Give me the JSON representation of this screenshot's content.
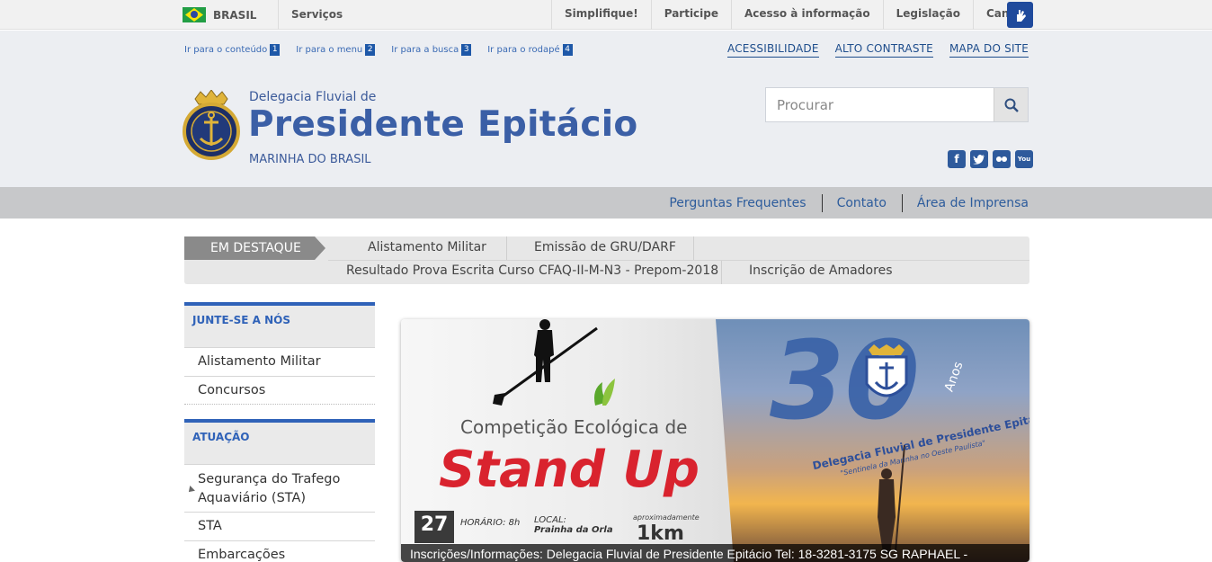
{
  "govbar": {
    "brasil_label": "BRASIL",
    "servicos_label": "Serviços",
    "links": [
      "Simplifique!",
      "Participe",
      "Acesso à informação",
      "Legislação",
      "Canais"
    ],
    "vlibras_icon": "vlibras-hand-icon"
  },
  "skip_links": [
    {
      "label": "Ir para o conteúdo",
      "num": "1"
    },
    {
      "label": "Ir para o menu",
      "num": "2"
    },
    {
      "label": "Ir para a busca",
      "num": "3"
    },
    {
      "label": "Ir para o rodapé",
      "num": "4"
    }
  ],
  "access_links": [
    "ACESSIBILIDADE",
    "ALTO CONTRASTE",
    "MAPA DO SITE"
  ],
  "site": {
    "small": "Delegacia Fluvial de",
    "title": "Presidente Epitácio",
    "subtitle": "MARINHA DO BRASIL"
  },
  "search": {
    "placeholder": "Procurar",
    "value": ""
  },
  "social": [
    "facebook-icon",
    "twitter-icon",
    "flickr-icon",
    "youtube-icon"
  ],
  "navstrip": [
    "Perguntas Frequentes",
    "Contato",
    "Área de Imprensa"
  ],
  "destaque": {
    "tag": "EM DESTAQUE",
    "items": [
      "Alistamento Militar",
      "Emissão de GRU/DARF",
      "Resultado Prova Escrita Curso CFAQ-II-M-N3 - Prepom-2018",
      "Inscrição de Amadores"
    ]
  },
  "sidebar": {
    "section1": {
      "title": "JUNTE-SE A NÓS",
      "items": [
        "Alistamento Militar",
        "Concursos"
      ]
    },
    "section2": {
      "title": "ATUAÇÃO",
      "items": [
        "Segurança do Trafego Aquaviário (STA)",
        "STA",
        "Embarcações"
      ]
    }
  },
  "banner": {
    "comp_line": "Competição Ecológica de",
    "headline": "Stand Up",
    "day": "27",
    "horario": "HORÁRIO: 8h",
    "local_label": "LOCAL:",
    "local_value": "Prainha da Orla",
    "approx": "aproximadamente",
    "distance": "1km",
    "anos_number": "30",
    "anos_label": "Anos",
    "ribbon": "Delegacia Fluvial de Presidente Epitácio",
    "motto": "\"Sentinela da Marinha no Oeste Paulista\"",
    "caption": "Inscrições/Informações: Delegacia Fluvial de Presidente Epitácio Tel: 18-3281-3175 SG RAPHAEL -"
  },
  "colors": {
    "brand_blue": "#3b5fa6",
    "accent": "#2f62b8",
    "headline_red": "#d9232e"
  }
}
